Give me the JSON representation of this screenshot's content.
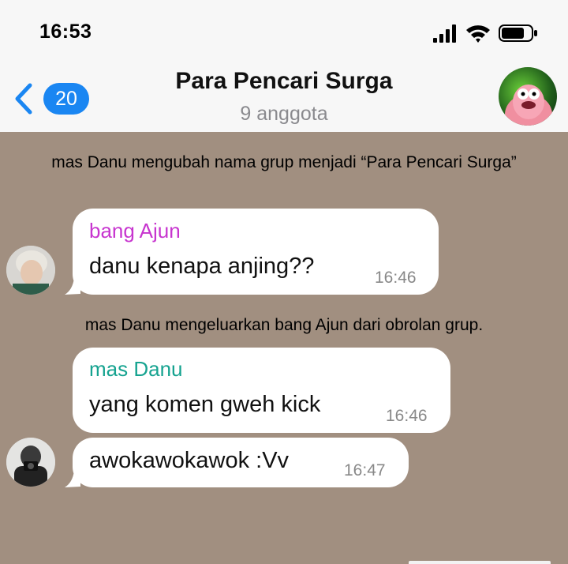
{
  "status_bar": {
    "time": "16:53"
  },
  "header": {
    "back_count": "20",
    "title": "Para Pencari Surga",
    "subtitle": "9 anggota"
  },
  "messages": {
    "system_1": "mas Danu mengubah nama grup menjadi “Para Pencari Surga”",
    "bubble_1": {
      "sender": "bang Ajun",
      "text": "danu kenapa anjing??",
      "time": "16:46",
      "sender_color": "#c735cf"
    },
    "system_2": "mas Danu mengeluarkan bang Ajun dari obrolan grup.",
    "bubble_2": {
      "sender": "mas Danu",
      "text": "yang komen gweh kick",
      "time": "16:46",
      "sender_color": "#16a390"
    },
    "bubble_3": {
      "text": "awokawokawok :Vv",
      "time": "16:47"
    }
  },
  "colors": {
    "chat_background": "#a18f80",
    "accent": "#1a86f2"
  }
}
